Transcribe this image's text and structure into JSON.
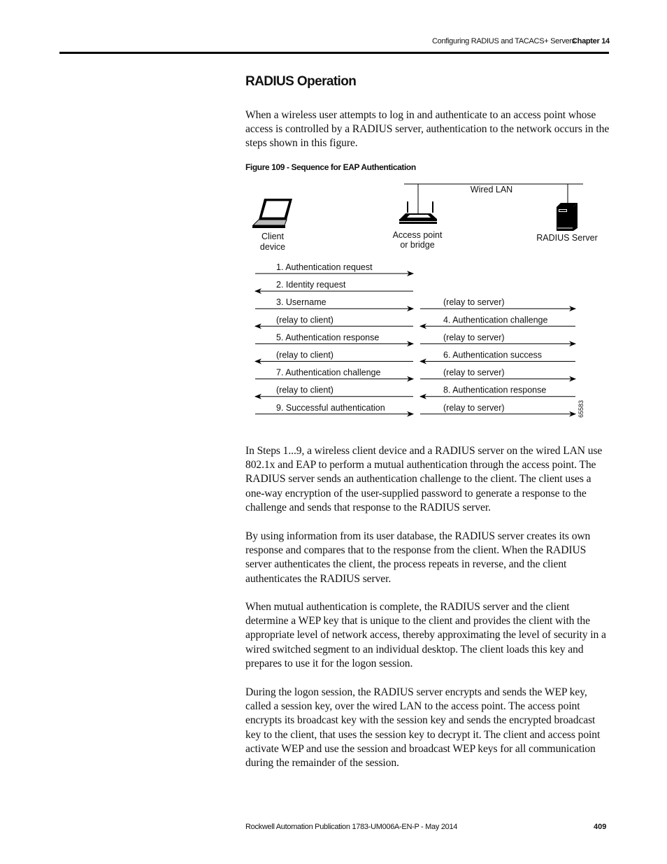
{
  "header": {
    "title": "Configuring RADIUS and TACACS+ Servers",
    "chapter": "Chapter 14"
  },
  "section_title": "RADIUS Operation",
  "intro": "When a wireless user attempts to log in and authenticate to an access point whose access is controlled by a RADIUS server, authentication to the network occurs in the steps shown in this figure.",
  "figure": {
    "caption": "Figure 109 - Sequence for EAP Authentication",
    "network_label": "Wired LAN",
    "nodes": {
      "client": [
        "Client",
        "device"
      ],
      "access_point": [
        "Access point",
        "or bridge"
      ],
      "server": "RADIUS Server"
    },
    "left_messages": [
      {
        "label": "1. Authentication request",
        "dir": "right"
      },
      {
        "label": "2. Identity request",
        "dir": "left"
      },
      {
        "label": "3. Username",
        "dir": "right"
      },
      {
        "label": "(relay to client)",
        "dir": "left"
      },
      {
        "label": "5. Authentication response",
        "dir": "right"
      },
      {
        "label": "(relay to client)",
        "dir": "left"
      },
      {
        "label": "7. Authentication challenge",
        "dir": "right"
      },
      {
        "label": "(relay to client)",
        "dir": "left"
      },
      {
        "label": "9. Successful authentication",
        "dir": "right"
      }
    ],
    "right_messages": [
      null,
      null,
      {
        "label": "(relay to server)",
        "dir": "right"
      },
      {
        "label": "4. Authentication challenge",
        "dir": "left"
      },
      {
        "label": "(relay to server)",
        "dir": "right"
      },
      {
        "label": "6. Authentication success",
        "dir": "left"
      },
      {
        "label": "(relay to server)",
        "dir": "right"
      },
      {
        "label": "8. Authentication response",
        "dir": "left"
      },
      {
        "label": "(relay to server)",
        "dir": "right"
      }
    ],
    "figure_id": "65583"
  },
  "paragraphs": [
    "In Steps 1...9, a wireless client device and a RADIUS server on the wired LAN use 802.1x and EAP to perform a mutual authentication through the access point. The RADIUS server sends an authentication challenge to the client. The client uses a one-way encryption of the user-supplied password to generate a response to the challenge and sends that response to the RADIUS server.",
    "By using information from its user database, the RADIUS server creates its own response and compares that to the response from the client. When the RADIUS server authenticates the client, the process repeats in reverse, and the client authenticates the RADIUS server.",
    "When mutual authentication is complete, the RADIUS server and the client determine a WEP key that is unique to the client and provides the client with the appropriate level of network access, thereby approximating the level of security in a wired switched segment to an individual desktop. The client loads this key and prepares to use it for the logon session.",
    "During the logon session, the RADIUS server encrypts and sends the WEP key, called a session key, over the wired LAN to the access point. The access point encrypts its broadcast key with the session key and sends the encrypted broadcast key to the client, that uses the session key to decrypt it. The client and access point activate WEP and use the session and broadcast WEP keys for all communication during the remainder of the session."
  ],
  "footer": {
    "publication": "Rockwell Automation Publication 1783-UM006A-EN-P - May 2014",
    "page": "409"
  }
}
